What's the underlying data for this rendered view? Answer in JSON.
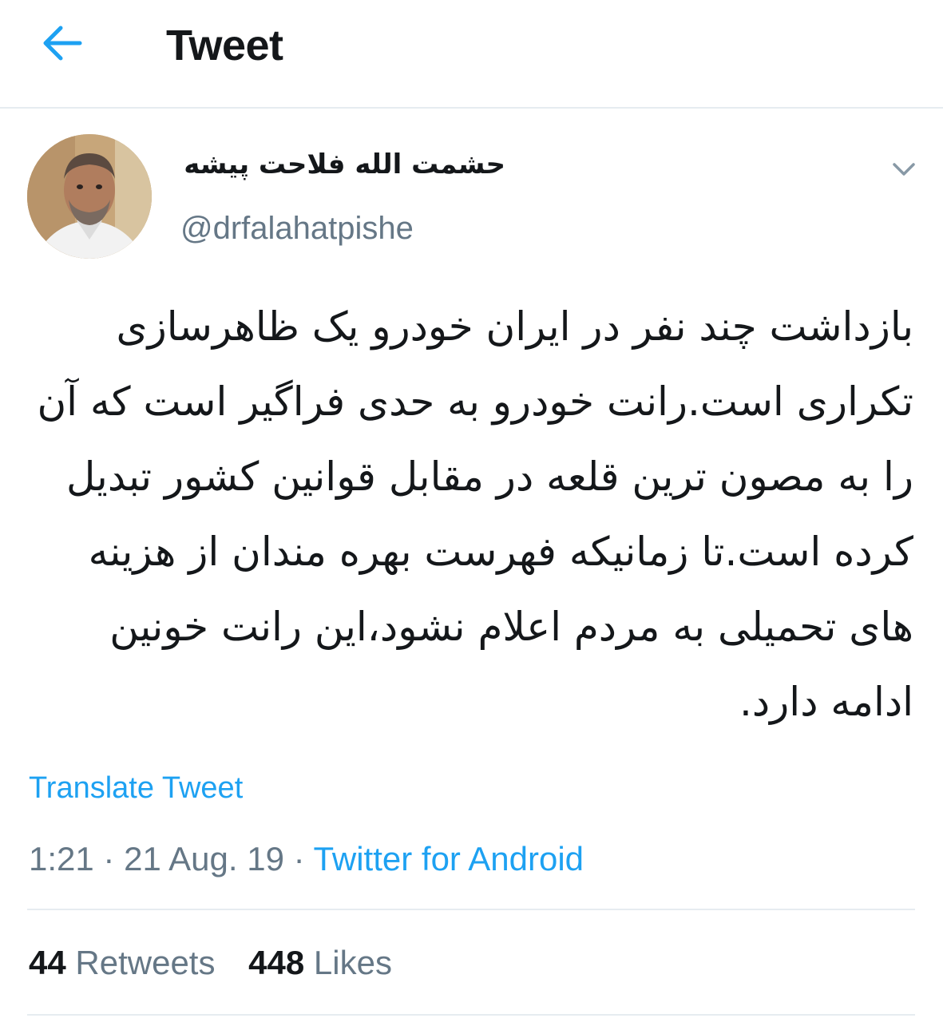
{
  "header": {
    "title": "Tweet",
    "back_icon": "arrow-left-icon"
  },
  "author": {
    "display_name": "حشمت الله فلاحت پیشه",
    "handle": "@drfalahatpishe",
    "avatar_icon": "profile-photo"
  },
  "tweet": {
    "text": "بازداشت چند نفر در ایران خودرو یک ظاهرسازی تکراری است.رانت خودرو به حدی فراگیر است که آن را به مصون ترین قلعه در مقابل قوانین کشور تبدیل کرده است.تا زمانیکه فهرست بهره مندان از هزینه های تحمیلی به مردم اعلام نشود،این رانت خونین ادامه دارد.",
    "translate_label": "Translate Tweet",
    "time": "1:21",
    "date": "21 Aug. 19",
    "separator": "·",
    "source": "Twitter for Android"
  },
  "stats": {
    "retweets_count": "44",
    "retweets_label": "Retweets",
    "likes_count": "448",
    "likes_label": "Likes"
  },
  "colors": {
    "accent": "#1da1f2",
    "text": "#14171a",
    "secondary": "#657786",
    "divider": "#e6ecf0"
  }
}
